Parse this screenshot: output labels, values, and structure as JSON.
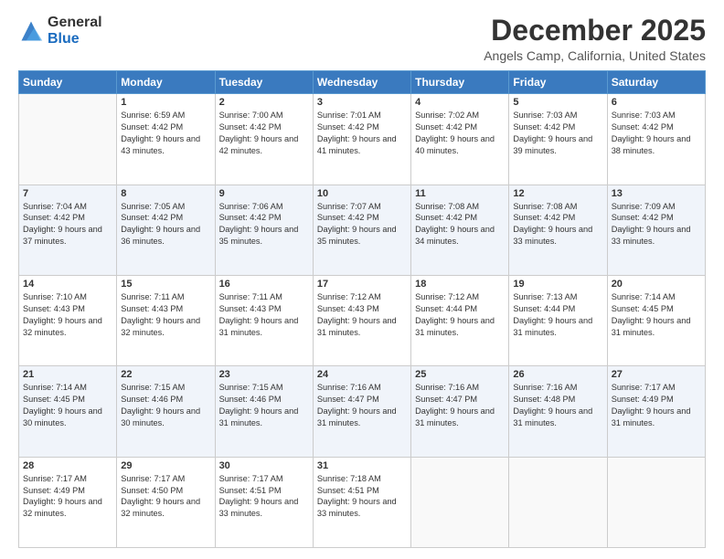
{
  "logo": {
    "general": "General",
    "blue": "Blue"
  },
  "header": {
    "month": "December 2025",
    "location": "Angels Camp, California, United States"
  },
  "weekdays": [
    "Sunday",
    "Monday",
    "Tuesday",
    "Wednesday",
    "Thursday",
    "Friday",
    "Saturday"
  ],
  "weeks": [
    [
      {
        "day": "",
        "sunrise": "",
        "sunset": "",
        "daylight": ""
      },
      {
        "day": "1",
        "sunrise": "Sunrise: 6:59 AM",
        "sunset": "Sunset: 4:42 PM",
        "daylight": "Daylight: 9 hours and 43 minutes."
      },
      {
        "day": "2",
        "sunrise": "Sunrise: 7:00 AM",
        "sunset": "Sunset: 4:42 PM",
        "daylight": "Daylight: 9 hours and 42 minutes."
      },
      {
        "day": "3",
        "sunrise": "Sunrise: 7:01 AM",
        "sunset": "Sunset: 4:42 PM",
        "daylight": "Daylight: 9 hours and 41 minutes."
      },
      {
        "day": "4",
        "sunrise": "Sunrise: 7:02 AM",
        "sunset": "Sunset: 4:42 PM",
        "daylight": "Daylight: 9 hours and 40 minutes."
      },
      {
        "day": "5",
        "sunrise": "Sunrise: 7:03 AM",
        "sunset": "Sunset: 4:42 PM",
        "daylight": "Daylight: 9 hours and 39 minutes."
      },
      {
        "day": "6",
        "sunrise": "Sunrise: 7:03 AM",
        "sunset": "Sunset: 4:42 PM",
        "daylight": "Daylight: 9 hours and 38 minutes."
      }
    ],
    [
      {
        "day": "7",
        "sunrise": "Sunrise: 7:04 AM",
        "sunset": "Sunset: 4:42 PM",
        "daylight": "Daylight: 9 hours and 37 minutes."
      },
      {
        "day": "8",
        "sunrise": "Sunrise: 7:05 AM",
        "sunset": "Sunset: 4:42 PM",
        "daylight": "Daylight: 9 hours and 36 minutes."
      },
      {
        "day": "9",
        "sunrise": "Sunrise: 7:06 AM",
        "sunset": "Sunset: 4:42 PM",
        "daylight": "Daylight: 9 hours and 35 minutes."
      },
      {
        "day": "10",
        "sunrise": "Sunrise: 7:07 AM",
        "sunset": "Sunset: 4:42 PM",
        "daylight": "Daylight: 9 hours and 35 minutes."
      },
      {
        "day": "11",
        "sunrise": "Sunrise: 7:08 AM",
        "sunset": "Sunset: 4:42 PM",
        "daylight": "Daylight: 9 hours and 34 minutes."
      },
      {
        "day": "12",
        "sunrise": "Sunrise: 7:08 AM",
        "sunset": "Sunset: 4:42 PM",
        "daylight": "Daylight: 9 hours and 33 minutes."
      },
      {
        "day": "13",
        "sunrise": "Sunrise: 7:09 AM",
        "sunset": "Sunset: 4:42 PM",
        "daylight": "Daylight: 9 hours and 33 minutes."
      }
    ],
    [
      {
        "day": "14",
        "sunrise": "Sunrise: 7:10 AM",
        "sunset": "Sunset: 4:43 PM",
        "daylight": "Daylight: 9 hours and 32 minutes."
      },
      {
        "day": "15",
        "sunrise": "Sunrise: 7:11 AM",
        "sunset": "Sunset: 4:43 PM",
        "daylight": "Daylight: 9 hours and 32 minutes."
      },
      {
        "day": "16",
        "sunrise": "Sunrise: 7:11 AM",
        "sunset": "Sunset: 4:43 PM",
        "daylight": "Daylight: 9 hours and 31 minutes."
      },
      {
        "day": "17",
        "sunrise": "Sunrise: 7:12 AM",
        "sunset": "Sunset: 4:43 PM",
        "daylight": "Daylight: 9 hours and 31 minutes."
      },
      {
        "day": "18",
        "sunrise": "Sunrise: 7:12 AM",
        "sunset": "Sunset: 4:44 PM",
        "daylight": "Daylight: 9 hours and 31 minutes."
      },
      {
        "day": "19",
        "sunrise": "Sunrise: 7:13 AM",
        "sunset": "Sunset: 4:44 PM",
        "daylight": "Daylight: 9 hours and 31 minutes."
      },
      {
        "day": "20",
        "sunrise": "Sunrise: 7:14 AM",
        "sunset": "Sunset: 4:45 PM",
        "daylight": "Daylight: 9 hours and 31 minutes."
      }
    ],
    [
      {
        "day": "21",
        "sunrise": "Sunrise: 7:14 AM",
        "sunset": "Sunset: 4:45 PM",
        "daylight": "Daylight: 9 hours and 30 minutes."
      },
      {
        "day": "22",
        "sunrise": "Sunrise: 7:15 AM",
        "sunset": "Sunset: 4:46 PM",
        "daylight": "Daylight: 9 hours and 30 minutes."
      },
      {
        "day": "23",
        "sunrise": "Sunrise: 7:15 AM",
        "sunset": "Sunset: 4:46 PM",
        "daylight": "Daylight: 9 hours and 31 minutes."
      },
      {
        "day": "24",
        "sunrise": "Sunrise: 7:16 AM",
        "sunset": "Sunset: 4:47 PM",
        "daylight": "Daylight: 9 hours and 31 minutes."
      },
      {
        "day": "25",
        "sunrise": "Sunrise: 7:16 AM",
        "sunset": "Sunset: 4:47 PM",
        "daylight": "Daylight: 9 hours and 31 minutes."
      },
      {
        "day": "26",
        "sunrise": "Sunrise: 7:16 AM",
        "sunset": "Sunset: 4:48 PM",
        "daylight": "Daylight: 9 hours and 31 minutes."
      },
      {
        "day": "27",
        "sunrise": "Sunrise: 7:17 AM",
        "sunset": "Sunset: 4:49 PM",
        "daylight": "Daylight: 9 hours and 31 minutes."
      }
    ],
    [
      {
        "day": "28",
        "sunrise": "Sunrise: 7:17 AM",
        "sunset": "Sunset: 4:49 PM",
        "daylight": "Daylight: 9 hours and 32 minutes."
      },
      {
        "day": "29",
        "sunrise": "Sunrise: 7:17 AM",
        "sunset": "Sunset: 4:50 PM",
        "daylight": "Daylight: 9 hours and 32 minutes."
      },
      {
        "day": "30",
        "sunrise": "Sunrise: 7:17 AM",
        "sunset": "Sunset: 4:51 PM",
        "daylight": "Daylight: 9 hours and 33 minutes."
      },
      {
        "day": "31",
        "sunrise": "Sunrise: 7:18 AM",
        "sunset": "Sunset: 4:51 PM",
        "daylight": "Daylight: 9 hours and 33 minutes."
      },
      {
        "day": "",
        "sunrise": "",
        "sunset": "",
        "daylight": ""
      },
      {
        "day": "",
        "sunrise": "",
        "sunset": "",
        "daylight": ""
      },
      {
        "day": "",
        "sunrise": "",
        "sunset": "",
        "daylight": ""
      }
    ]
  ]
}
